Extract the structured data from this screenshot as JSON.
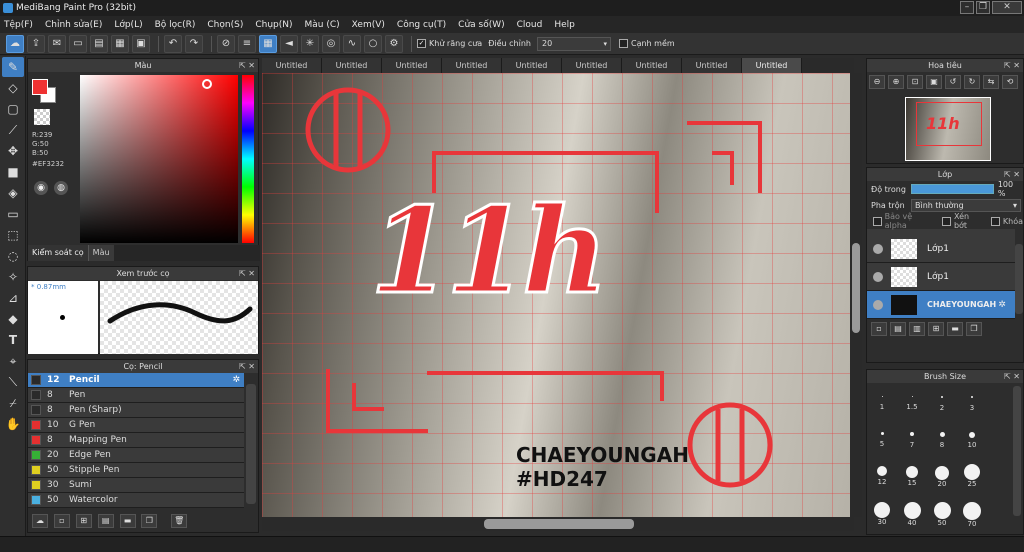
{
  "app": {
    "title": "MediBang Paint Pro (32bit)"
  },
  "menu": [
    "Tệp(F)",
    "Chỉnh sửa(E)",
    "Lớp(L)",
    "Bộ lọc(R)",
    "Chọn(S)",
    "Chụp(N)",
    "Màu (C)",
    "Xem(V)",
    "Công cụ(T)",
    "Cửa số(W)",
    "Cloud",
    "Help"
  ],
  "toolbar": {
    "antialias_label": "Khử răng cưa",
    "correction_label": "Điều chỉnh",
    "correction_value": "20",
    "sharp_label": "Cạnh mềm"
  },
  "color_panel": {
    "title": "Màu",
    "r": "R:239",
    "g": "G:50",
    "b": "B:50",
    "hex": "#EF3232",
    "tab_control": "Kiểm soát cọ",
    "tab_color": "Màu",
    "primary": "#ef3232"
  },
  "preview_panel": {
    "title": "Xem trước cọ",
    "size": "0.87mm"
  },
  "brush_panel": {
    "title": "Cọ: Pencil",
    "items": [
      {
        "size": "12",
        "name": "Pencil",
        "color": "#2a2a2a"
      },
      {
        "size": "8",
        "name": "Pen",
        "color": "#2a2a2a"
      },
      {
        "size": "8",
        "name": "Pen (Sharp)",
        "color": "#2a2a2a"
      },
      {
        "size": "10",
        "name": "G Pen",
        "color": "#e53030"
      },
      {
        "size": "8",
        "name": "Mapping Pen",
        "color": "#e53030"
      },
      {
        "size": "20",
        "name": "Edge Pen",
        "color": "#36b036"
      },
      {
        "size": "50",
        "name": "Stipple Pen",
        "color": "#e0d020"
      },
      {
        "size": "30",
        "name": "Sumi",
        "color": "#e0d020"
      },
      {
        "size": "50",
        "name": "Watercolor",
        "color": "#4ab0e0"
      }
    ]
  },
  "tabs": [
    "Untitled",
    "Untitled",
    "Untitled",
    "Untitled",
    "Untitled",
    "Untitled",
    "Untitled",
    "Untitled",
    "Untitled"
  ],
  "artwork": {
    "big_text": "11h",
    "caption1": "CHAEYOUNGAH",
    "caption2": "#HD247",
    "accent": "#e8363a"
  },
  "navigator": {
    "title": "Hoa tiêu"
  },
  "layer_panel": {
    "title": "Lớp",
    "opacity_label": "Độ trong",
    "opacity_value": "100 %",
    "blend_label": "Pha trộn",
    "blend_value": "Bình thường",
    "protect_alpha": "Bảo vệ alpha",
    "clip": "Xén bớt",
    "lock": "Khóa",
    "layers": [
      {
        "name": "Lớp1"
      },
      {
        "name": "Lớp1"
      },
      {
        "name": "CHAEYOUNGAH"
      }
    ]
  },
  "brush_size": {
    "title": "Brush Size",
    "sizes": [
      "1",
      "1.5",
      "2",
      "3",
      "5",
      "7",
      "8",
      "10",
      "12",
      "15",
      "20",
      "25",
      "30",
      "40",
      "50",
      "70"
    ]
  }
}
